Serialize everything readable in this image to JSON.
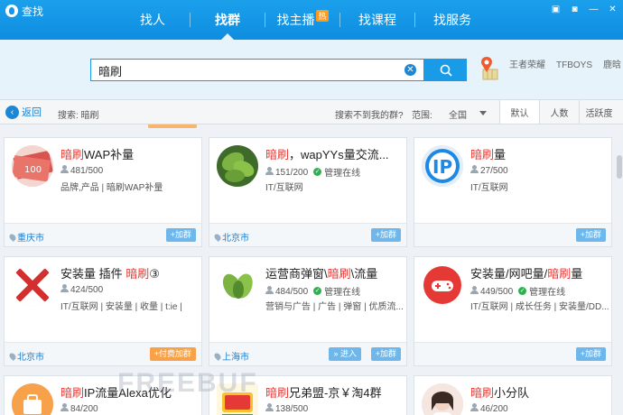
{
  "window": {
    "title": "查找"
  },
  "tabs": [
    {
      "label": "找人"
    },
    {
      "label": "找群"
    },
    {
      "label": "找主播",
      "badge": "热"
    },
    {
      "label": "找课程"
    },
    {
      "label": "找服务"
    }
  ],
  "search": {
    "query": "暗刷"
  },
  "hot_words": [
    "王者荣耀",
    "TFBOYS",
    "鹿晗"
  ],
  "filter": {
    "back_label": "返回",
    "crumb": "搜索: 暗刷",
    "not_found": "搜索不到我的群?",
    "range_label": "范围:",
    "range_value": "全国",
    "sorts": [
      "默认",
      "人数",
      "活跃度"
    ]
  },
  "cards": [
    {
      "pre": "",
      "hl": "暗刷",
      "post": "WAP补量",
      "members": "481/500",
      "admin": "",
      "tags": "品牌,产品  |  暗刷WAP补量",
      "city": "重庆市",
      "buttons": [
        "+加群"
      ]
    },
    {
      "pre": "",
      "hl": "暗刷",
      "post": "，wapYYs量交流...",
      "members": "151/200",
      "admin": "管理在线",
      "tags": "IT/互联网",
      "city": "北京市",
      "buttons": [
        "+加群"
      ]
    },
    {
      "pre": "",
      "hl": "暗刷",
      "post": "量",
      "members": "27/500",
      "admin": "",
      "tags": "IT/互联网",
      "city": "",
      "buttons": [
        "+加群"
      ]
    },
    {
      "pre": "安装量 插件 ",
      "hl": "暗刷",
      "post": "③",
      "members": "424/500",
      "admin": "",
      "tags": "IT/互联网  |  安装量  |  收量  |  t:ie  |",
      "city": "北京市",
      "buttons": [
        "+付费加群"
      ]
    },
    {
      "pre": "运营商弹窗\\",
      "hl": "暗刷",
      "post": "\\流量",
      "members": "484/500",
      "admin": "管理在线",
      "tags": "营销与广告  |  广告  |  弹窗  |  优质流...",
      "city": "上海市",
      "buttons": [
        "» 进入",
        "+加群"
      ]
    },
    {
      "pre": "安装量/网吧量/",
      "hl": "暗刷",
      "post": "量",
      "members": "449/500",
      "admin": "管理在线",
      "tags": "IT/互联网  |  成长任务  |  安装量/DD...",
      "city": "",
      "buttons": [
        "+加群"
      ]
    },
    {
      "pre": "",
      "hl": "暗刷",
      "post": "IP流量Alexa优化",
      "members": "84/200",
      "admin": "",
      "tags": "",
      "city": "",
      "buttons": []
    },
    {
      "pre": "",
      "hl": "暗刷",
      "post": "兄弟盟-京￥淘4群",
      "members": "138/500",
      "admin": "",
      "tags": "",
      "city": "",
      "buttons": []
    },
    {
      "pre": "",
      "hl": "暗刷",
      "post": "小分队",
      "members": "46/200",
      "admin": "",
      "tags": "",
      "city": "",
      "buttons": []
    }
  ],
  "watermark": "FREEBUF",
  "colors": {
    "brand": "#1596e6",
    "highlight": "#e53935",
    "paid": "#f7a24b"
  }
}
